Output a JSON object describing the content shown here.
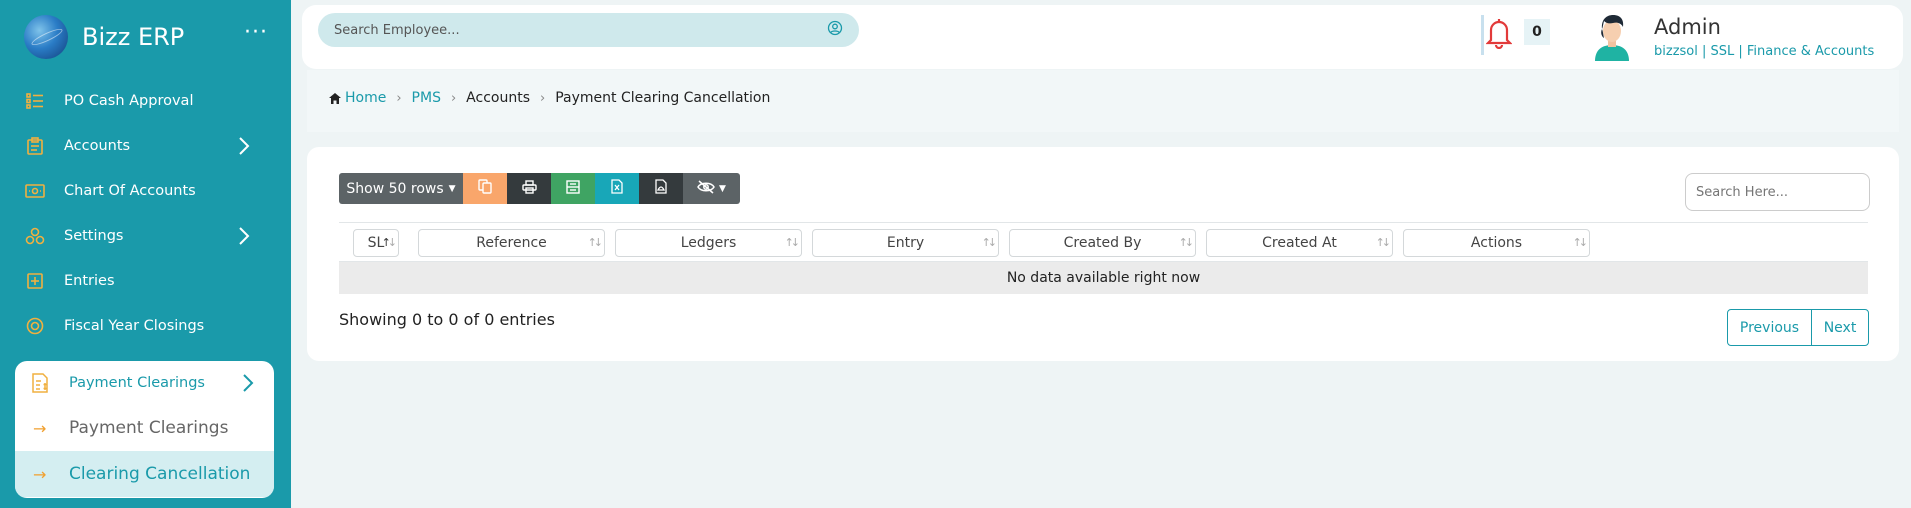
{
  "sidebar": {
    "brand": "Bizz ERP",
    "menu_icon": "more-dots-icon",
    "items": [
      {
        "label": "PO Cash Approval",
        "icon": "list-icon"
      },
      {
        "label": "Accounts",
        "icon": "clipboard-icon",
        "has_children": true
      },
      {
        "label": "Chart Of Accounts",
        "icon": "money-icon"
      },
      {
        "label": "Settings",
        "icon": "cog-group-icon",
        "has_children": true
      },
      {
        "label": "Entries",
        "icon": "plus-box-icon"
      },
      {
        "label": "Fiscal Year Closings",
        "icon": "coin-icon"
      }
    ],
    "submenu": {
      "label": "Payment Clearings",
      "icon": "invoice-icon",
      "items": [
        {
          "label": "Payment Clearings",
          "active": false
        },
        {
          "label": "Clearing Cancellation",
          "active": true
        }
      ]
    }
  },
  "topbar": {
    "search_placeholder": "Search Employee...",
    "notification_count": "0",
    "user": {
      "name": "Admin",
      "meta": "bizzsol | SSL  | Finance & Accounts"
    }
  },
  "breadcrumb": {
    "home": "Home",
    "items": [
      "PMS",
      "Accounts",
      "Payment Clearing Cancellation"
    ]
  },
  "table": {
    "toolbar": {
      "rows_label": "Show 50 rows",
      "buttons": [
        "copy-icon",
        "print-icon",
        "csv-icon",
        "excel-icon",
        "pdf-icon",
        "eye-slash-icon"
      ]
    },
    "search_placeholder": "Search Here...",
    "columns": [
      "SL",
      "Reference",
      "Ledgers",
      "Entry",
      "Created By",
      "Created At",
      "Actions"
    ],
    "rows": [],
    "empty_message": "No data available right now",
    "info": "Showing 0 to 0 of 0 entries",
    "pagination": {
      "previous": "Previous",
      "next": "Next"
    }
  },
  "colors": {
    "primary": "#1a9aaa",
    "accent": "#f0a030",
    "background": "#eef4f5"
  }
}
